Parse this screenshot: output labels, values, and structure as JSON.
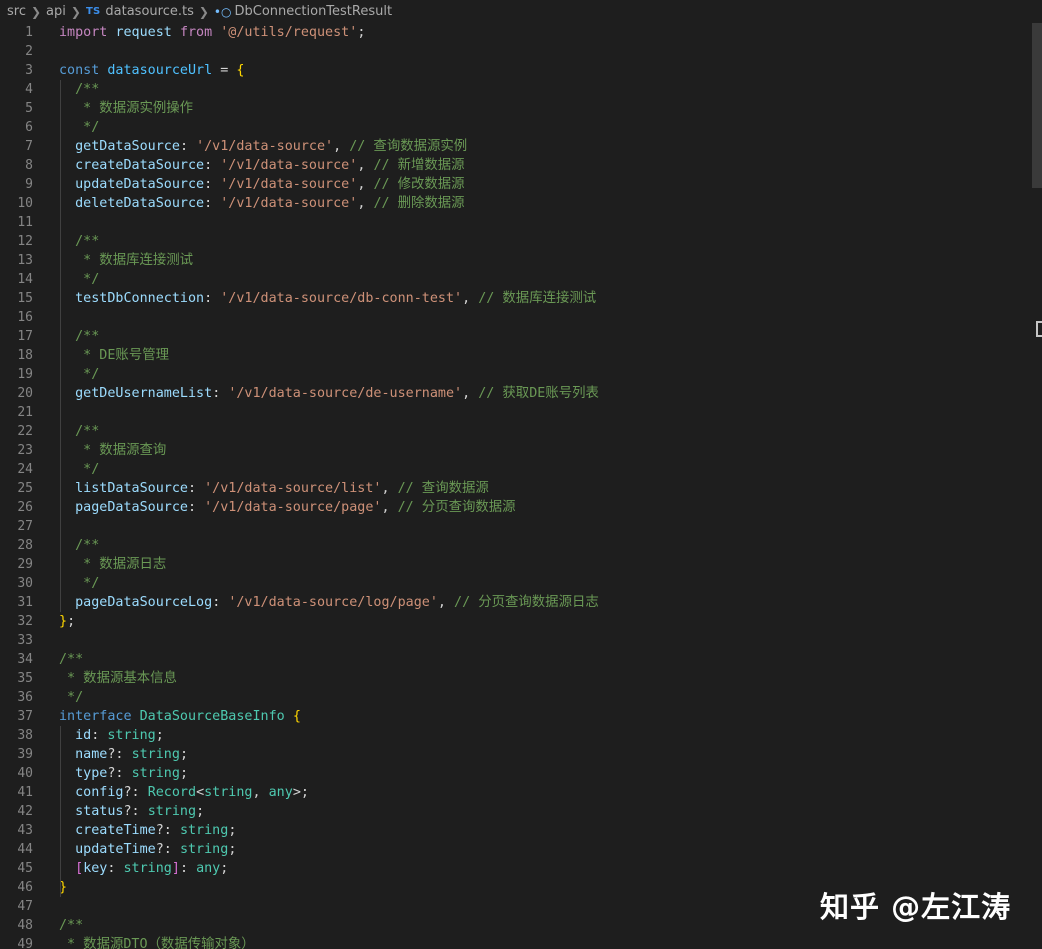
{
  "breadcrumb": {
    "items": [
      "src",
      "api",
      "datasource.ts",
      "DbConnectionTestResult"
    ],
    "file_badge": "TS",
    "symbol_icon": "symbol-interface-icon"
  },
  "watermark": "知乎 @左江涛",
  "colors": {
    "background": "#1e1e1e",
    "line_number": "#858585",
    "keyword_control": "#c586c0",
    "keyword": "#569cd6",
    "variable": "#9cdcfe",
    "string": "#ce9178",
    "comment": "#6a9955",
    "type": "#4ec9b0",
    "bracket": "#ffd700"
  },
  "lines": [
    [
      [
        "k1",
        "import"
      ],
      [
        "p",
        " "
      ],
      [
        "v",
        "request"
      ],
      [
        "p",
        " "
      ],
      [
        "k1",
        "from"
      ],
      [
        "p",
        " "
      ],
      [
        "s",
        "'@/utils/request'"
      ],
      [
        "p",
        ";"
      ]
    ],
    [],
    [
      [
        "k2",
        "const"
      ],
      [
        "p",
        " "
      ],
      [
        "vc",
        "datasourceUrl"
      ],
      [
        "p",
        " = "
      ],
      [
        "b1",
        "{"
      ]
    ],
    [
      [
        "c",
        "  /**"
      ]
    ],
    [
      [
        "c",
        "   * 数据源实例操作"
      ]
    ],
    [
      [
        "c",
        "   */"
      ]
    ],
    [
      [
        "p",
        "  "
      ],
      [
        "v",
        "getDataSource"
      ],
      [
        "p",
        ": "
      ],
      [
        "s",
        "'/v1/data-source'"
      ],
      [
        "p",
        ", "
      ],
      [
        "c",
        "// 查询数据源实例"
      ]
    ],
    [
      [
        "p",
        "  "
      ],
      [
        "v",
        "createDataSource"
      ],
      [
        "p",
        ": "
      ],
      [
        "s",
        "'/v1/data-source'"
      ],
      [
        "p",
        ", "
      ],
      [
        "c",
        "// 新增数据源"
      ]
    ],
    [
      [
        "p",
        "  "
      ],
      [
        "v",
        "updateDataSource"
      ],
      [
        "p",
        ": "
      ],
      [
        "s",
        "'/v1/data-source'"
      ],
      [
        "p",
        ", "
      ],
      [
        "c",
        "// 修改数据源"
      ]
    ],
    [
      [
        "p",
        "  "
      ],
      [
        "v",
        "deleteDataSource"
      ],
      [
        "p",
        ": "
      ],
      [
        "s",
        "'/v1/data-source'"
      ],
      [
        "p",
        ", "
      ],
      [
        "c",
        "// 删除数据源"
      ]
    ],
    [],
    [
      [
        "c",
        "  /**"
      ]
    ],
    [
      [
        "c",
        "   * 数据库连接测试"
      ]
    ],
    [
      [
        "c",
        "   */"
      ]
    ],
    [
      [
        "p",
        "  "
      ],
      [
        "v",
        "testDbConnection"
      ],
      [
        "p",
        ": "
      ],
      [
        "s",
        "'/v1/data-source/db-conn-test'"
      ],
      [
        "p",
        ", "
      ],
      [
        "c",
        "// 数据库连接测试"
      ]
    ],
    [],
    [
      [
        "c",
        "  /**"
      ]
    ],
    [
      [
        "c",
        "   * DE账号管理"
      ]
    ],
    [
      [
        "c",
        "   */"
      ]
    ],
    [
      [
        "p",
        "  "
      ],
      [
        "v",
        "getDeUsernameList"
      ],
      [
        "p",
        ": "
      ],
      [
        "s",
        "'/v1/data-source/de-username'"
      ],
      [
        "p",
        ", "
      ],
      [
        "c",
        "// 获取DE账号列表"
      ]
    ],
    [],
    [
      [
        "c",
        "  /**"
      ]
    ],
    [
      [
        "c",
        "   * 数据源查询"
      ]
    ],
    [
      [
        "c",
        "   */"
      ]
    ],
    [
      [
        "p",
        "  "
      ],
      [
        "v",
        "listDataSource"
      ],
      [
        "p",
        ": "
      ],
      [
        "s",
        "'/v1/data-source/list'"
      ],
      [
        "p",
        ", "
      ],
      [
        "c",
        "// 查询数据源"
      ]
    ],
    [
      [
        "p",
        "  "
      ],
      [
        "v",
        "pageDataSource"
      ],
      [
        "p",
        ": "
      ],
      [
        "s",
        "'/v1/data-source/page'"
      ],
      [
        "p",
        ", "
      ],
      [
        "c",
        "// 分页查询数据源"
      ]
    ],
    [],
    [
      [
        "c",
        "  /**"
      ]
    ],
    [
      [
        "c",
        "   * 数据源日志"
      ]
    ],
    [
      [
        "c",
        "   */"
      ]
    ],
    [
      [
        "p",
        "  "
      ],
      [
        "v",
        "pageDataSourceLog"
      ],
      [
        "p",
        ": "
      ],
      [
        "s",
        "'/v1/data-source/log/page'"
      ],
      [
        "p",
        ", "
      ],
      [
        "c",
        "// 分页查询数据源日志"
      ]
    ],
    [
      [
        "b1",
        "}"
      ],
      [
        "p",
        ";"
      ]
    ],
    [],
    [
      [
        "c",
        "/**"
      ]
    ],
    [
      [
        "c",
        " * 数据源基本信息"
      ]
    ],
    [
      [
        "c",
        " */"
      ]
    ],
    [
      [
        "k2",
        "interface"
      ],
      [
        "p",
        " "
      ],
      [
        "t",
        "DataSourceBaseInfo"
      ],
      [
        "p",
        " "
      ],
      [
        "b1",
        "{"
      ]
    ],
    [
      [
        "p",
        "  "
      ],
      [
        "v",
        "id"
      ],
      [
        "p",
        ": "
      ],
      [
        "t",
        "string"
      ],
      [
        "p",
        ";"
      ]
    ],
    [
      [
        "p",
        "  "
      ],
      [
        "v",
        "name"
      ],
      [
        "p",
        "?: "
      ],
      [
        "t",
        "string"
      ],
      [
        "p",
        ";"
      ]
    ],
    [
      [
        "p",
        "  "
      ],
      [
        "v",
        "type"
      ],
      [
        "p",
        "?: "
      ],
      [
        "t",
        "string"
      ],
      [
        "p",
        ";"
      ]
    ],
    [
      [
        "p",
        "  "
      ],
      [
        "v",
        "config"
      ],
      [
        "p",
        "?: "
      ],
      [
        "t",
        "Record"
      ],
      [
        "p",
        "<"
      ],
      [
        "t",
        "string"
      ],
      [
        "p",
        ", "
      ],
      [
        "t",
        "any"
      ],
      [
        "p",
        ">;"
      ]
    ],
    [
      [
        "p",
        "  "
      ],
      [
        "v",
        "status"
      ],
      [
        "p",
        "?: "
      ],
      [
        "t",
        "string"
      ],
      [
        "p",
        ";"
      ]
    ],
    [
      [
        "p",
        "  "
      ],
      [
        "v",
        "createTime"
      ],
      [
        "p",
        "?: "
      ],
      [
        "t",
        "string"
      ],
      [
        "p",
        ";"
      ]
    ],
    [
      [
        "p",
        "  "
      ],
      [
        "v",
        "updateTime"
      ],
      [
        "p",
        "?: "
      ],
      [
        "t",
        "string"
      ],
      [
        "p",
        ";"
      ]
    ],
    [
      [
        "p",
        "  "
      ],
      [
        "b2",
        "["
      ],
      [
        "v",
        "key"
      ],
      [
        "p",
        ": "
      ],
      [
        "t",
        "string"
      ],
      [
        "b2",
        "]"
      ],
      [
        "p",
        ": "
      ],
      [
        "t",
        "any"
      ],
      [
        "p",
        ";"
      ]
    ],
    [
      [
        "b1",
        "}"
      ]
    ],
    [],
    [
      [
        "c",
        "/**"
      ]
    ],
    [
      [
        "c",
        " * 数据源DTO（数据传输对象）"
      ]
    ]
  ]
}
